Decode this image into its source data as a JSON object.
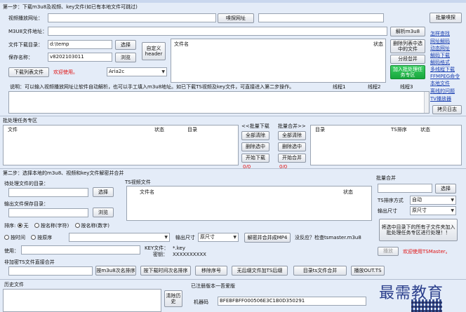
{
  "step1": {
    "title": "第一步：下载m3u8及视频、key文件(如已有本地文件可跳过)",
    "video_url_label": "视频播放网址：",
    "sniff_btn": "嗅探网址",
    "batch_sniff_btn": "批量嗅探",
    "m3u8_url_label": "M3U8文件地址：",
    "parse_btn": "解析m3u8",
    "download_dir_label": "文件下载目录：",
    "download_dir_value": "d:\\temp",
    "choose_btn": "选择",
    "save_name_label": "保存名称：",
    "save_name_value": "v8202103011",
    "browse_btn": "浏览",
    "custom_header_btn": "自定义header",
    "file_col": "文件名",
    "status_col": "状态",
    "delete_selected_file_btn": "删除列表中选中的文件",
    "segment_merge_btn": "分段합并",
    "batch_add_btn": "加入批处理任务专区",
    "download_list_btn": "下载列表文件",
    "welcome_text": "欢迎使用。",
    "downloader_value": "Aria2c",
    "info_text": "说明：可以输入视频播放网址让软件自动解析，也可以手工填入m3u8地址。如已下载TS视频及key文件，可直接进入第二步操作。",
    "thread1": "线程1",
    "thread2": "线程2",
    "thread3": "线程3",
    "copy_log_btn": "拷贝日志"
  },
  "links": [
    "怎样查找",
    "网址解码",
    "动态网址",
    "解码下载",
    "解码格式",
    "多线程下载",
    "FFMPEG命令",
    "本地文件",
    "离线的问题",
    "TV播放器"
  ],
  "batch": {
    "title": "批处理任务专区",
    "file_col": "文件",
    "status_col": "状态",
    "dir_col": "目录",
    "batch_download_label": "<<批量下载",
    "batch_merge_label": "批量合并>>",
    "clear_all_1": "全部清除",
    "clear_all_2": "全部清除",
    "delete_sel_1": "删除选中",
    "delete_sel_2": "删除选中",
    "start_download": "开始下载",
    "start_merge": "开始合并",
    "count1": "0/0",
    "count2": "0/0",
    "right_dir_col": "目录",
    "right_ts_col": "TS排序",
    "right_status_col": "状态"
  },
  "step2": {
    "title": "第二步：选择本地的m3u8、视频和key文件解密并合并",
    "pending_dir_label": "待处理文件的目录：",
    "choose_btn": "选择",
    "output_dir_label": "输出文件保存目录：",
    "browse_btn": "浏览",
    "ts_files_label": "TS视频文件",
    "file_col": "文件名",
    "status_col": "状态",
    "sort_label": "排序:",
    "sort_none": "无",
    "sort_by_name_char": "按名称(字符)",
    "sort_by_name_num": "按名称(数字)",
    "by_time": "按时间",
    "by_order": "按原序",
    "output_size_label": "输出尺寸",
    "output_size_value": "原尺寸",
    "decrypt_merge_btn": "解密并合并成MP4",
    "no_response_text": "没反应？检查tsmaster.m3u8",
    "use_label": "使用：",
    "key_file_label": "KEY文件：",
    "key_file_value": "*.key",
    "password_label": "密钥：",
    "password_value": "XXXXXXXXXX",
    "non_encrypted_label": "非加密TS文件直接合并",
    "btn_m3u8_sort": "按m3u8次名排序",
    "btn_time_sort": "按下载时间次名排序",
    "btn_remove_seq": "移除序号",
    "btn_no_rename_merge": "无后缀文件加TS后缀",
    "btn_dir_merge": "目录ts文件合并",
    "btn_play_out": "播放OUT.TS"
  },
  "batch_merge": {
    "title": "批量合并",
    "choose_btn": "选择",
    "ts_sort_label": "TS排序方式",
    "ts_sort_value": "自动",
    "output_size_label": "输出尺寸",
    "output_size_value": "原尺寸",
    "merge_all_btn": "将选中目录下的所有子文件夹加入批处理任务专区进行处理！！",
    "play_btn": "播放",
    "welcome_text": "欢迎使用TSMaster。"
  },
  "bottom": {
    "history_label": "历史文件",
    "clear_history_btn": "清除历史",
    "reg_text": "已注册版本一吾爱版",
    "machine_code_label": "机器码",
    "machine_code_value": "BFEBFBFF000506E3C1B0D350291",
    "watermark": "最需教育"
  },
  "colors": {
    "window_bg": "#e4ecf8",
    "green_button": "#17a63c",
    "link": "#1a3fb0",
    "welcome_red": "#e01010"
  }
}
